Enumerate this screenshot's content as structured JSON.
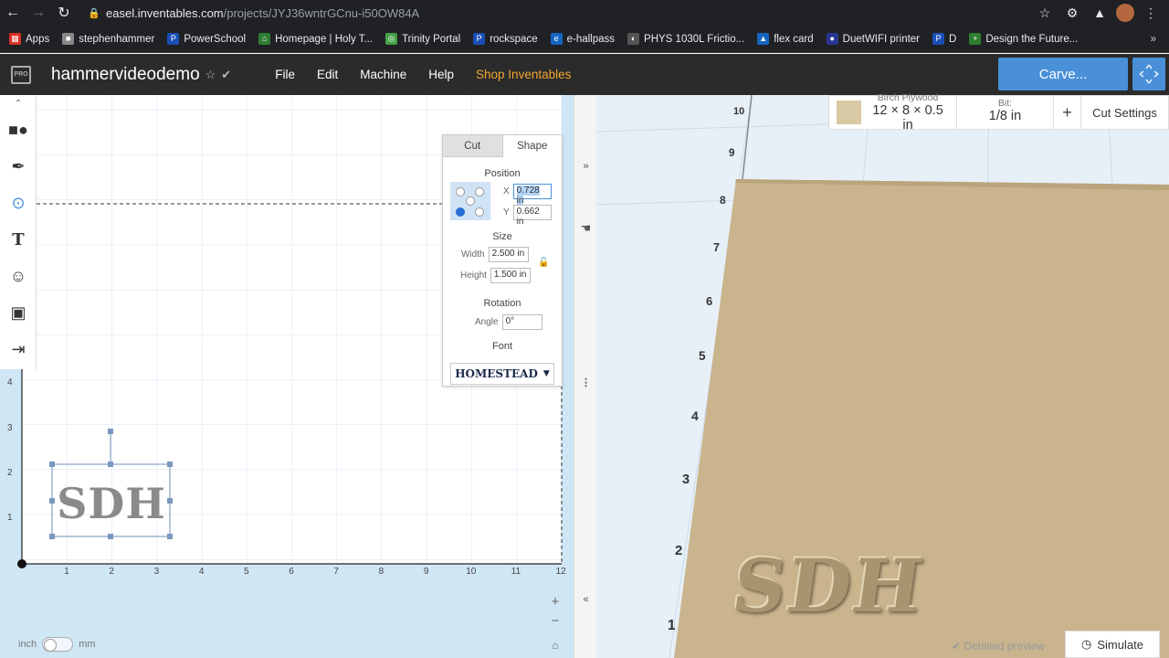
{
  "browser": {
    "url_host": "easel.inventables.com",
    "url_path": "/projects/JYJ36wntrGCnu-i50OW84A",
    "bookmarks": [
      "Apps",
      "stephenhammer",
      "PowerSchool",
      "Homepage | Holy T...",
      "Trinity Portal",
      "rockspace",
      "e-hallpass",
      "PHYS 1030L Frictio...",
      "flex card",
      "DuetWIFI printer",
      "D",
      "Design the Future..."
    ]
  },
  "header": {
    "logo": "PRO",
    "project_title": "hammervideodemo",
    "menu": [
      "File",
      "Edit",
      "Machine",
      "Help",
      "Shop Inventables"
    ],
    "carve_label": "Carve..."
  },
  "shape_panel": {
    "tab_cut": "Cut",
    "tab_shape": "Shape",
    "position_label": "Position",
    "x_label": "X",
    "x_value": "0.728 in",
    "y_label": "Y",
    "y_value": "0.662 in",
    "size_label": "Size",
    "width_label": "Width",
    "width_value": "2.500 in",
    "height_label": "Height",
    "height_value": "1.500 in",
    "rotation_label": "Rotation",
    "angle_label": "Angle",
    "angle_value": "0°",
    "font_label": "Font",
    "font_value": "HOMESTEAD"
  },
  "canvas": {
    "text_object": "SDH",
    "x_ticks": [
      "1",
      "2",
      "3",
      "4",
      "5",
      "6",
      "7",
      "8",
      "9",
      "10",
      "11",
      "12"
    ],
    "y_ticks": [
      "1",
      "2",
      "3",
      "4"
    ]
  },
  "material_bar": {
    "material_name": "Birch Plywood",
    "material_size": "12 × 8 × 0.5 in",
    "bit_label": "Bit:",
    "bit_value": "1/8 in",
    "plus": "+",
    "cut_settings": "Cut Settings"
  },
  "preview": {
    "carved_text": "SDH",
    "ruler_labels": [
      "10",
      "9",
      "8",
      "7",
      "6",
      "5",
      "4",
      "3",
      "2",
      "1"
    ],
    "detailed_preview": "Detailed preview",
    "simulate": "Simulate"
  },
  "units": {
    "inch": "inch",
    "mm": "mm"
  },
  "colors": {
    "accent": "#4a90d9",
    "shop": "#f2a632",
    "header_bg": "#2b2b2b",
    "wood": "#c9b48e"
  }
}
